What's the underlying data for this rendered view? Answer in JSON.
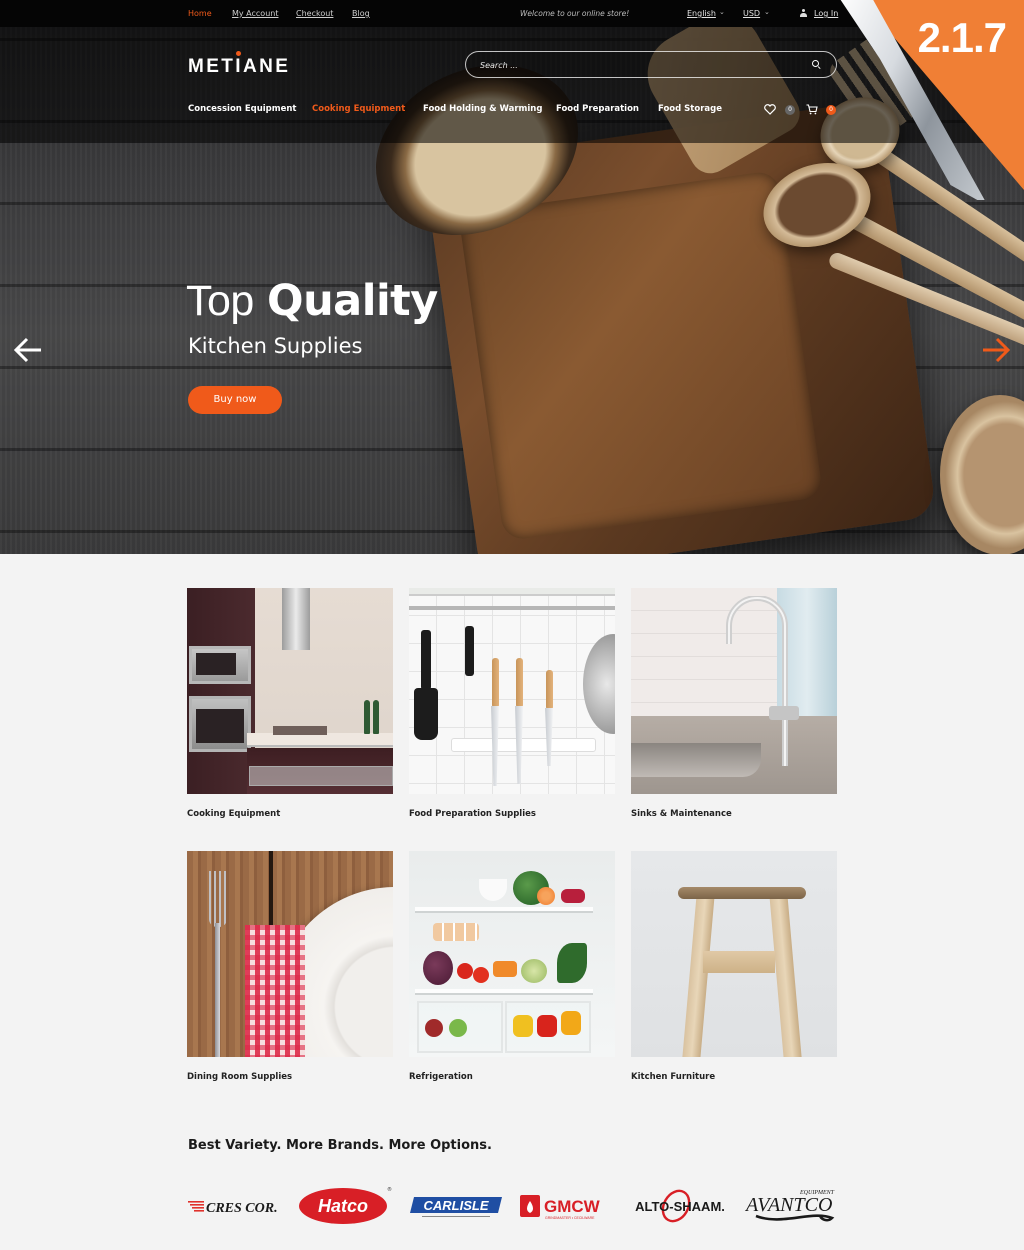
{
  "topbar": {
    "links": [
      {
        "label": "Home",
        "active": true
      },
      {
        "label": "My Account",
        "active": false
      },
      {
        "label": "Checkout",
        "active": false
      },
      {
        "label": "Blog",
        "active": false
      }
    ],
    "welcome": "Welcome to our online store!",
    "language": "English",
    "currency": "USD",
    "login": "Log In"
  },
  "header": {
    "logo": "METIANE",
    "search_placeholder": "Search ...",
    "wishlist_count": "0",
    "cart_count": "0"
  },
  "nav": {
    "items": [
      {
        "label": "Concession Equipment",
        "active": false
      },
      {
        "label": "Cooking Equipment",
        "active": true
      },
      {
        "label": "Food Holding & Warming",
        "active": false
      },
      {
        "label": "Food Preparation",
        "active": false
      },
      {
        "label": "Food Storage",
        "active": false
      }
    ]
  },
  "hero": {
    "title_light": "Top",
    "title_bold": "Quality",
    "subtitle": "Kitchen Supplies",
    "button": "Buy now"
  },
  "ribbon": {
    "version": "2.1.7"
  },
  "categories": [
    {
      "label": "Cooking Equipment"
    },
    {
      "label": "Food Preparation Supplies"
    },
    {
      "label": "Sinks & Maintenance"
    },
    {
      "label": "Dining Room Supplies"
    },
    {
      "label": "Refrigeration"
    },
    {
      "label": "Kitchen Furniture"
    }
  ],
  "brands": {
    "title": "Best Variety. More Brands. More Options.",
    "items": [
      {
        "name": "CRES COR."
      },
      {
        "name": "Hatco"
      },
      {
        "name": "CARLISLE"
      },
      {
        "name": "GMCW",
        "sub": "GRINDMASTER • CECILWARE"
      },
      {
        "name": "ALTO-SHAAM."
      },
      {
        "name": "AVANTCO",
        "sub": "EQUIPMENT"
      }
    ]
  },
  "colors": {
    "accent": "#f05a1a",
    "ribbon": "#f07f35",
    "background": "#f3f3f3"
  }
}
